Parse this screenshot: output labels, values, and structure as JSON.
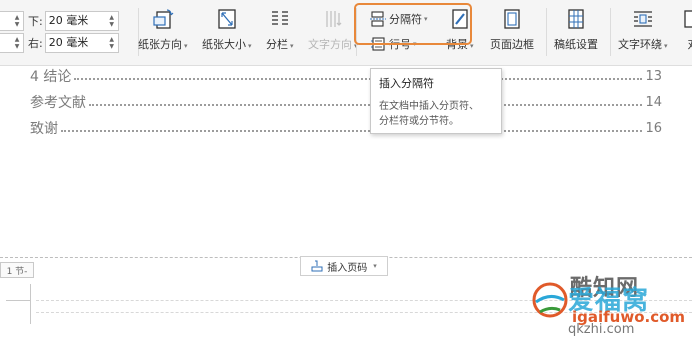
{
  "ribbon": {
    "margin_bottom_label": "下:",
    "margin_bottom_value": "20 毫米",
    "margin_right_label": "右:",
    "margin_right_value": "20 毫米",
    "tools": {
      "orientation": "纸张方向",
      "size": "纸张大小",
      "columns": "分栏",
      "text_direction": "文字方向",
      "breaks": "分隔符",
      "line_numbers": "行号",
      "background": "背景",
      "page_border": "页面边框",
      "manuscript": "稿纸设置",
      "wrap_text": "文字环绕",
      "align_partial": "对"
    }
  },
  "tooltip": {
    "title": "插入分隔符",
    "desc_line1": "在文档中插入分页符、",
    "desc_line2": "分栏符或分节符。"
  },
  "document": {
    "toc": [
      {
        "text": "4 结论",
        "page": "13"
      },
      {
        "text": "参考文献",
        "page": "14"
      },
      {
        "text": "致谢",
        "page": "16"
      }
    ],
    "section_tag": "1 节-",
    "insert_page_number": "插入页码"
  },
  "watermark": {
    "line1": "酷知网",
    "line2": "爱福窝",
    "url": "igaifuwo.com",
    "url2": "qkzhi.com"
  },
  "colors": {
    "highlight": "#e8883a",
    "accent_blue": "#2f6fb7"
  }
}
